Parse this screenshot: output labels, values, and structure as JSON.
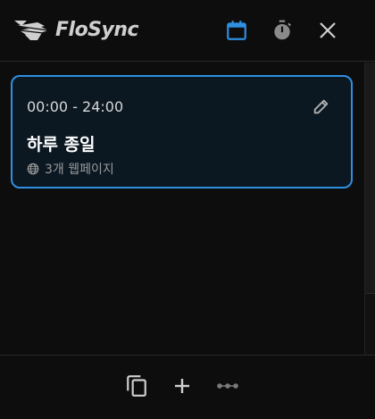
{
  "app": {
    "brand": "FloSync"
  },
  "header": {
    "icons": [
      "calendar-icon",
      "timer-icon",
      "close-icon"
    ],
    "accent": "#2f8fe0"
  },
  "schedules": [
    {
      "time": "00:00 - 24:00",
      "title": "하루 종일",
      "meta": "3개 웹페이지"
    }
  ],
  "footer": {
    "icons": [
      "copy-icon",
      "add-icon",
      "more-icon"
    ]
  },
  "colors": {
    "background": "#0d0d0d",
    "card_bg": "#0b1822",
    "card_border": "#2f8fe0",
    "muted_text": "#9a9a9a"
  }
}
